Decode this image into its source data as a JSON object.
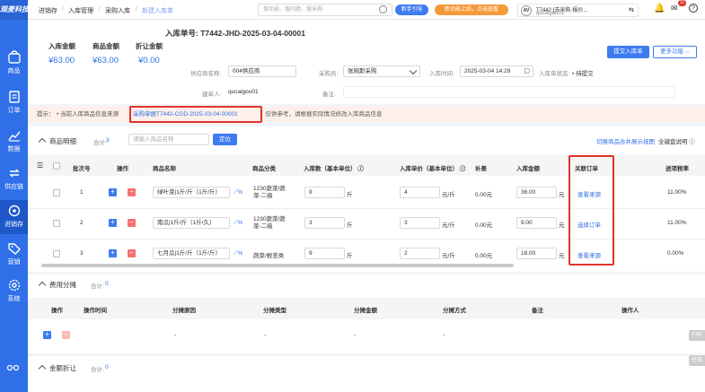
{
  "brand": {
    "logo": "观麦科技",
    "accent": "#2f6fe8"
  },
  "sidebar": {
    "items": [
      {
        "label": "商品",
        "icon": "shop-icon"
      },
      {
        "label": "订单",
        "icon": "order-icon"
      },
      {
        "label": "数据",
        "icon": "chart-icon"
      },
      {
        "label": "供应链",
        "icon": "supply-chain-icon"
      },
      {
        "label": "进销存",
        "icon": "inventory-icon",
        "active": true
      },
      {
        "label": "营销",
        "icon": "tag-icon"
      },
      {
        "label": "系统",
        "icon": "gear-icon"
      }
    ]
  },
  "topbar": {
    "breadcrumbs": [
      "进销存",
      "入库管理",
      "采购入库",
      "新建入库单"
    ],
    "search_placeholder": "搜功能、搜问题、搜采购",
    "guide_label": "新手引导",
    "promo_label": "新功能上线，点击查看",
    "user_name": "T7442 [去采购·报价...",
    "user_id": "qucaigou01",
    "badge_count": "11"
  },
  "header": {
    "stats": [
      {
        "label": "入库金额",
        "value": "¥63.00"
      },
      {
        "label": "商品金额",
        "value": "¥63.00"
      },
      {
        "label": "折让金额",
        "value": "¥0.00"
      }
    ],
    "doc_no_label": "入库单号:",
    "doc_no": "T7442-JHD-2025-03-04-00001",
    "supplier_label": "供应商名称:",
    "supplier": "004供应商",
    "purchaser_label": "采购员:",
    "purchaser": "张婉斯采购",
    "in_time_label": "入库时间:",
    "in_time": "2025-03-04 14:29",
    "status_label": "入库单状态:",
    "status": "待提交",
    "creator_label": "建单人:",
    "creator": "qucaigou01",
    "remark_label": "备注:",
    "submit_btn": "提交入库单",
    "more_btn": "更多功能"
  },
  "tip": {
    "prefix": "提示：",
    "text_before": "当前入库商品信息来源",
    "source": "采购单据T7442-CGD-2025-03-04-00001",
    "text_after": "，仅供参考，请根据实际情况修改入库商品信息"
  },
  "goods": {
    "title": "商品明细",
    "count_label": "合计:",
    "count": "3",
    "search_placeholder": "请输入商品名称",
    "locate_btn": "定位",
    "switch_link": "切换商品合并展示视图",
    "help_link": "全键盘说明",
    "columns": [
      "批次号",
      "操作",
      "商品名称",
      "商品分类",
      "入库数（基本单位）",
      "入库单价（基本单位）",
      "补差",
      "入库金额",
      "关联订单",
      "进项税率"
    ],
    "rows": [
      {
        "no": "1",
        "name": "绿叶菜|1斤/斤（1斤/斤）",
        "category": "1230蔬菜/蔬菜-二级",
        "qty": "9",
        "qty_unit": "斤",
        "price": "4",
        "price_unit": "元/斤",
        "diff": "0.00元",
        "amount": "36.00",
        "amount_unit": "元",
        "order_link": "查看来源",
        "tax": "11.00%"
      },
      {
        "no": "2",
        "name": "南瓜|1斤/斤（1斤/久）",
        "category": "1230蔬菜/蔬菜-二级",
        "qty": "3",
        "qty_unit": "斤",
        "price": "3",
        "price_unit": "元/斤",
        "diff": "0.00元",
        "amount": "9.00",
        "amount_unit": "元",
        "order_link": "选择订单",
        "tax": "11.00%"
      },
      {
        "no": "3",
        "name": "七月瓜|1斤/斤（1斤/斤）",
        "category": "蔬菜/根茎类",
        "qty": "9",
        "qty_unit": "斤",
        "price": "2",
        "price_unit": "元/斤",
        "diff": "0.00元",
        "amount": "18.00",
        "amount_unit": "元",
        "order_link": "查看来源",
        "tax": "0.00%"
      }
    ]
  },
  "fees": {
    "title": "费用分摊",
    "count_label": "合计:",
    "count": "0",
    "columns": [
      "操作",
      "操作时间",
      "分摊原因",
      "分摊类型",
      "分摊金额",
      "分摊方式",
      "备注",
      "操作人"
    ],
    "empty": "-",
    "side_btn": "扫码"
  },
  "discount": {
    "title": "金额折让",
    "count_label": "合计:",
    "count": "0",
    "side_btn": "任务"
  }
}
